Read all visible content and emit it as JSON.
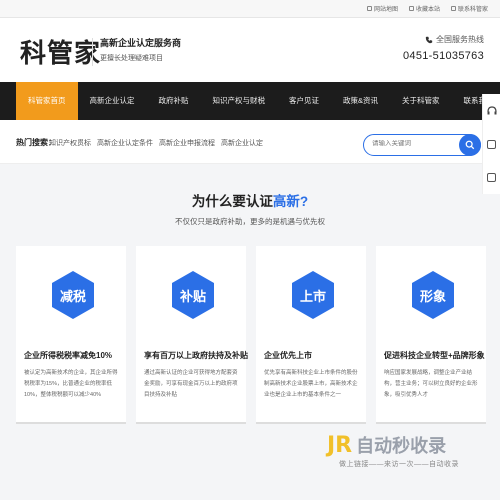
{
  "topbar": {
    "links": [
      {
        "label": "网站地图",
        "icon": "sitemap-icon"
      },
      {
        "label": "收藏本站",
        "icon": "bookmark-icon"
      },
      {
        "label": "联系科管家",
        "icon": "contact-icon"
      }
    ]
  },
  "header": {
    "logo": "科管家",
    "slogan_title": "高新企业认定服务商",
    "slogan_sub": "更擅长处理疑难项目",
    "hotline_label": "全国服务热线",
    "hotline_number": "0451-51035763"
  },
  "nav": {
    "items": [
      "科管家首页",
      "高新企业认定",
      "政府补贴",
      "知识产权与财税",
      "客户见证",
      "政策&资讯",
      "关于科管家",
      "联系我们"
    ],
    "active_index": 0
  },
  "hot_search": {
    "label": "热门搜索：",
    "links": [
      "知识产权贯标",
      "高新企业认定条件",
      "高新企业申报流程",
      "高新企业认定"
    ]
  },
  "search": {
    "placeholder": "请输入关键词"
  },
  "why": {
    "title_prefix": "为什么要认证",
    "title_highlight": "高新?",
    "subtitle": "不仅仅只是政府补助，更多的是机遇与优先权"
  },
  "cards": [
    {
      "badge": "减税",
      "title": "企业所得税税率减免10%",
      "desc": "被认定为高新技术的企业，其企业所得税税率为15%，比普通企业的税率低10%，整体税税额可以减少40%"
    },
    {
      "badge": "补贴",
      "title": "享有百万以上政府扶持及补贴",
      "desc": "通过高新认证的企业可获得地方配套资金奖励，可享有现金百万以上的政府项目扶持及补贴"
    },
    {
      "badge": "上市",
      "title": "企业优先上市",
      "desc": "优先享有高新科技企业上市条件的股份制高新技术企业股票上市，高新技术企业也是企业上市的基本条件之一"
    },
    {
      "badge": "形象",
      "title": "促进科技企业转型+品牌形象",
      "desc": "响应国家发展战略，调整企业产业结构，营主业务；可以树立良好的企业形象，吸引优秀人才"
    }
  ],
  "watermark": {
    "brand_mark": "JR",
    "brand_text": "自动秒收录",
    "tagline": "做上链接——来访一次——自动收录"
  },
  "colors": {
    "accent": "#2b6fe6",
    "nav_active": "#f29b1c",
    "nav_bg": "#1c1c1c"
  }
}
